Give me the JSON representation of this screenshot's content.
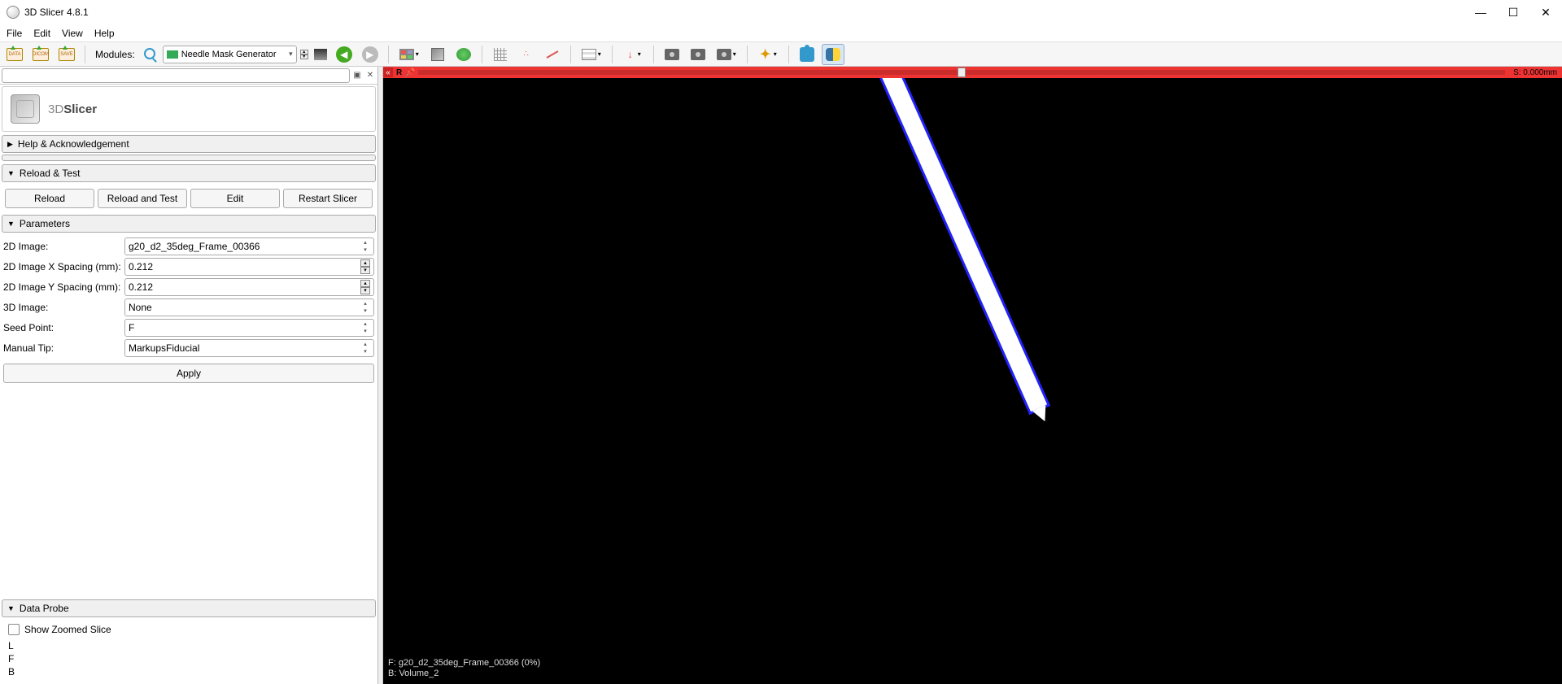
{
  "window": {
    "title": "3D Slicer 4.8.1"
  },
  "menu": {
    "file": "File",
    "edit": "Edit",
    "view": "View",
    "help": "Help"
  },
  "toolbar": {
    "data": "DATA",
    "dicom": "DICOM",
    "save": "SAVE",
    "modules_label": "Modules:",
    "module_selected": "Needle Mask Generator"
  },
  "logo": {
    "brand_prefix": "3D",
    "brand_main": "Slicer"
  },
  "sections": {
    "help": "Help & Acknowledgement",
    "reload": "Reload & Test",
    "parameters": "Parameters",
    "dataprobe": "Data Probe"
  },
  "buttons": {
    "reload": "Reload",
    "reload_test": "Reload and Test",
    "edit": "Edit",
    "restart": "Restart Slicer",
    "apply": "Apply"
  },
  "params": {
    "labels": {
      "image2d": "2D Image:",
      "xspacing": "2D Image X Spacing (mm):",
      "yspacing": "2D Image Y Spacing (mm):",
      "image3d": "3D Image:",
      "seed": "Seed Point:",
      "manual_tip": "Manual Tip:"
    },
    "values": {
      "image2d": "g20_d2_35deg_Frame_00366",
      "xspacing": "0.212",
      "yspacing": "0.212",
      "image3d": "None",
      "seed": "F",
      "manual_tip": "MarkupsFiducial"
    }
  },
  "dataprobe": {
    "show_zoomed": "Show Zoomed Slice",
    "L": "L",
    "F": "F",
    "B": "B"
  },
  "slice": {
    "orient": "R",
    "readout": "S: 0.000mm",
    "overlay_f": "F: g20_d2_35deg_Frame_00366 (0%)",
    "overlay_b": "B: Volume_2"
  }
}
